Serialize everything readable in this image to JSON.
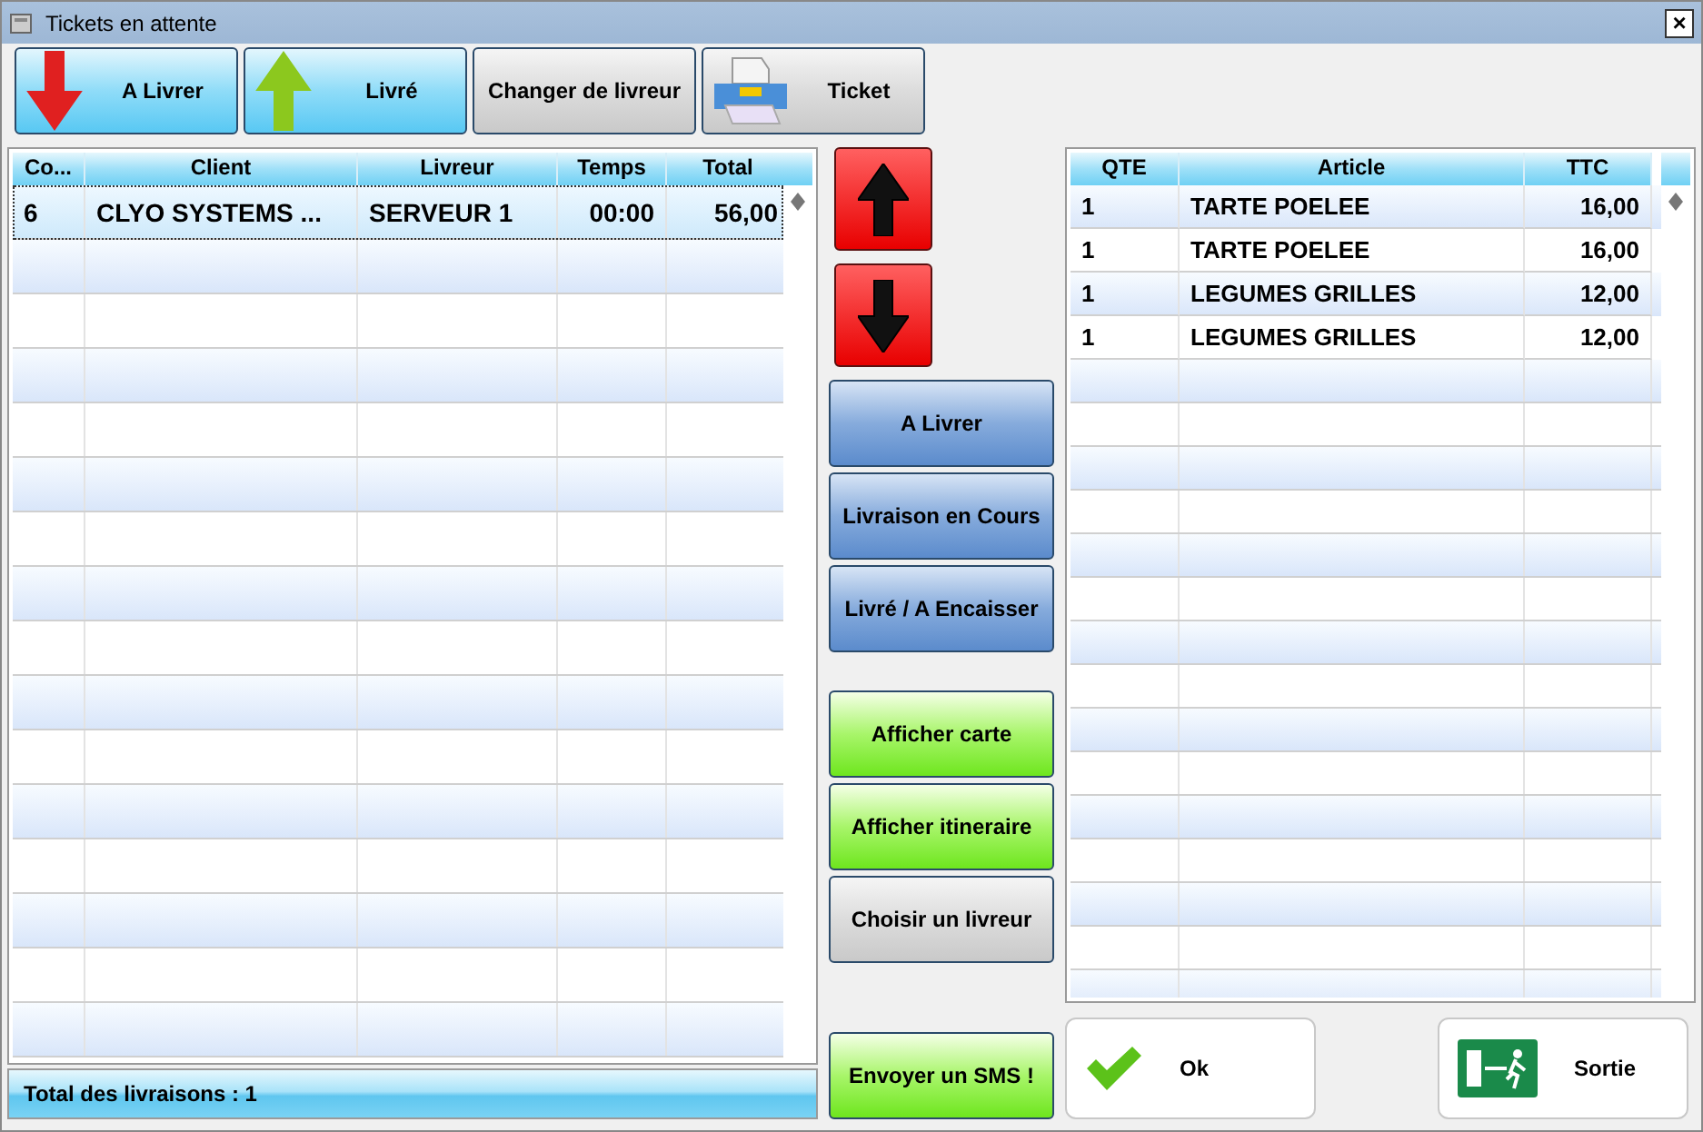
{
  "window": {
    "title": "Tickets en attente",
    "close": "×"
  },
  "toolbar": [
    {
      "label": "A Livrer",
      "kind": "down"
    },
    {
      "label": "Livré",
      "kind": "up"
    },
    {
      "label": "Changer de livreur",
      "kind": "plain"
    },
    {
      "label": "Ticket",
      "kind": "printer"
    }
  ],
  "deliveries": {
    "columns": [
      "Co...",
      "Client",
      "Livreur",
      "Temps",
      "Total"
    ],
    "rows": [
      {
        "cells": [
          "6",
          "CLYO SYSTEMS ...",
          "SERVEUR 1",
          "00:00",
          "56,00"
        ],
        "selected": true
      }
    ],
    "footer": "Total des livraisons : 1"
  },
  "side_buttons": [
    {
      "kind": "arrow-up"
    },
    {
      "kind": "arrow-down"
    },
    {
      "kind": "blue",
      "label": "A Livrer"
    },
    {
      "kind": "blue",
      "label": "Livraison en Cours"
    },
    {
      "kind": "blue",
      "label": "Livré / A Encaisser"
    },
    {
      "kind": "gap"
    },
    {
      "kind": "green",
      "label": "Afficher carte"
    },
    {
      "kind": "green",
      "label": "Afficher itineraire"
    },
    {
      "kind": "grey",
      "label": "Choisir un livreur"
    },
    {
      "kind": "spacer"
    },
    {
      "kind": "green",
      "label": "Envoyer un SMS !"
    }
  ],
  "items": {
    "columns": [
      "QTE",
      "Article",
      "TTC"
    ],
    "rows": [
      [
        "1",
        "TARTE POELEE",
        "16,00"
      ],
      [
        "1",
        "TARTE POELEE",
        "16,00"
      ],
      [
        "1",
        "LEGUMES GRILLES",
        "12,00"
      ],
      [
        "1",
        "LEGUMES GRILLES",
        "12,00"
      ]
    ]
  },
  "actions": [
    {
      "label": "Ok",
      "kind": "ok"
    },
    {
      "label": "Sortie",
      "kind": "exit"
    }
  ]
}
